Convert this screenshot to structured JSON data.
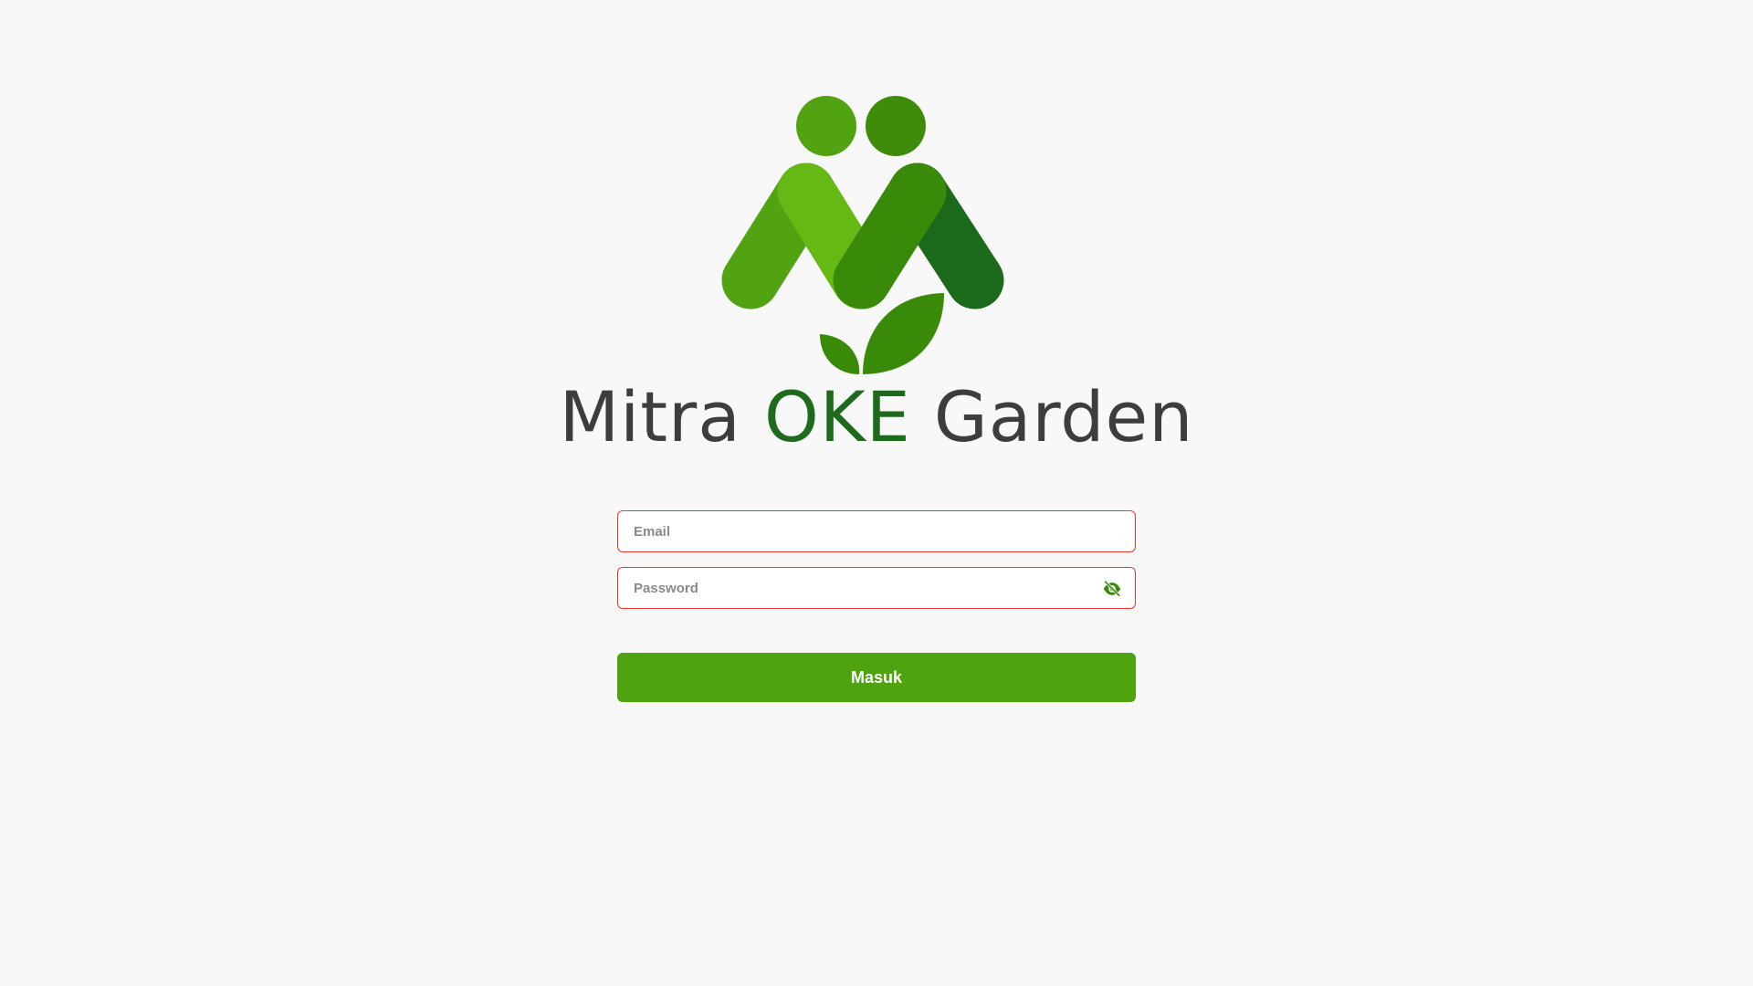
{
  "brand": {
    "name_part1": "Mitra ",
    "name_accent": "OKE",
    "name_part2": " Garden",
    "logo_icon": "mitra-oke-garden-logo-icon",
    "colors": {
      "text": "#3d3d3d",
      "accent": "#1f6b1d",
      "green_light": "#66b814",
      "green_mid": "#4ea30f",
      "green_dark": "#3a8a0a",
      "green_darker": "#1b6a1b"
    }
  },
  "login": {
    "email_placeholder": "Email",
    "email_value": "",
    "password_placeholder": "Password",
    "password_value": "",
    "password_toggle_icon": "eye-off-icon",
    "submit_label": "Masuk",
    "colors": {
      "field_border_error": "#e53935",
      "button_bg": "#4ea30f",
      "button_text": "#ffffff"
    }
  }
}
